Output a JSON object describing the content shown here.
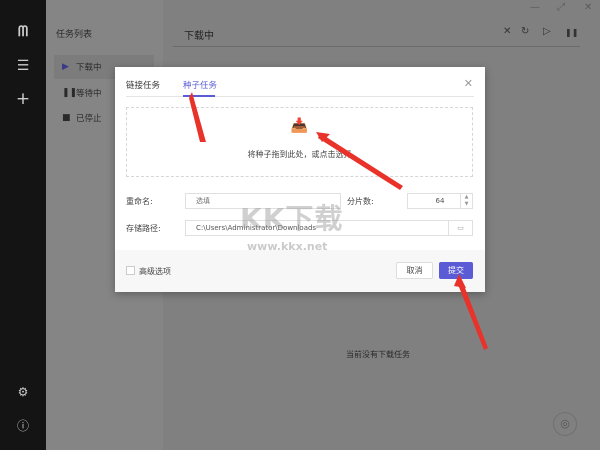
{
  "sidebar": {
    "icons": [
      "logo-icon",
      "menu-icon",
      "add-icon",
      "settings-sliders-icon",
      "help-icon"
    ]
  },
  "task_list": {
    "title": "任务列表",
    "items": [
      {
        "label": "下载中",
        "icon": "play-icon",
        "active": true
      },
      {
        "label": "等待中",
        "icon": "pause-icon"
      },
      {
        "label": "已停止",
        "icon": "stop-icon"
      }
    ]
  },
  "main": {
    "title": "下载中",
    "empty_text": "当前没有下载任务",
    "toolbar": {
      "close": "✕",
      "refresh": "↻",
      "start": "▷",
      "pause": "❚❚"
    },
    "window": {
      "minimize": "—",
      "maximize": "⤢",
      "close": "✕"
    }
  },
  "dialog": {
    "tabs": [
      {
        "label": "链接任务"
      },
      {
        "label": "种子任务",
        "active": true
      }
    ],
    "close": "✕",
    "dropzone": {
      "text": "将种子拖到此处，或点击选择"
    },
    "rename": {
      "label": "重命名:",
      "placeholder": "选填",
      "value": ""
    },
    "shards": {
      "label": "分片数:",
      "value": "64"
    },
    "path": {
      "label": "存储路径:",
      "value": "C:\\Users\\Administrator\\Downloads"
    },
    "advanced": {
      "label": "高级选项",
      "checked": false
    },
    "cancel": "取消",
    "submit": "提交",
    "accent": "#5b5bd6"
  },
  "watermark": {
    "text": "KK下载",
    "url": "www.kkx.net"
  }
}
